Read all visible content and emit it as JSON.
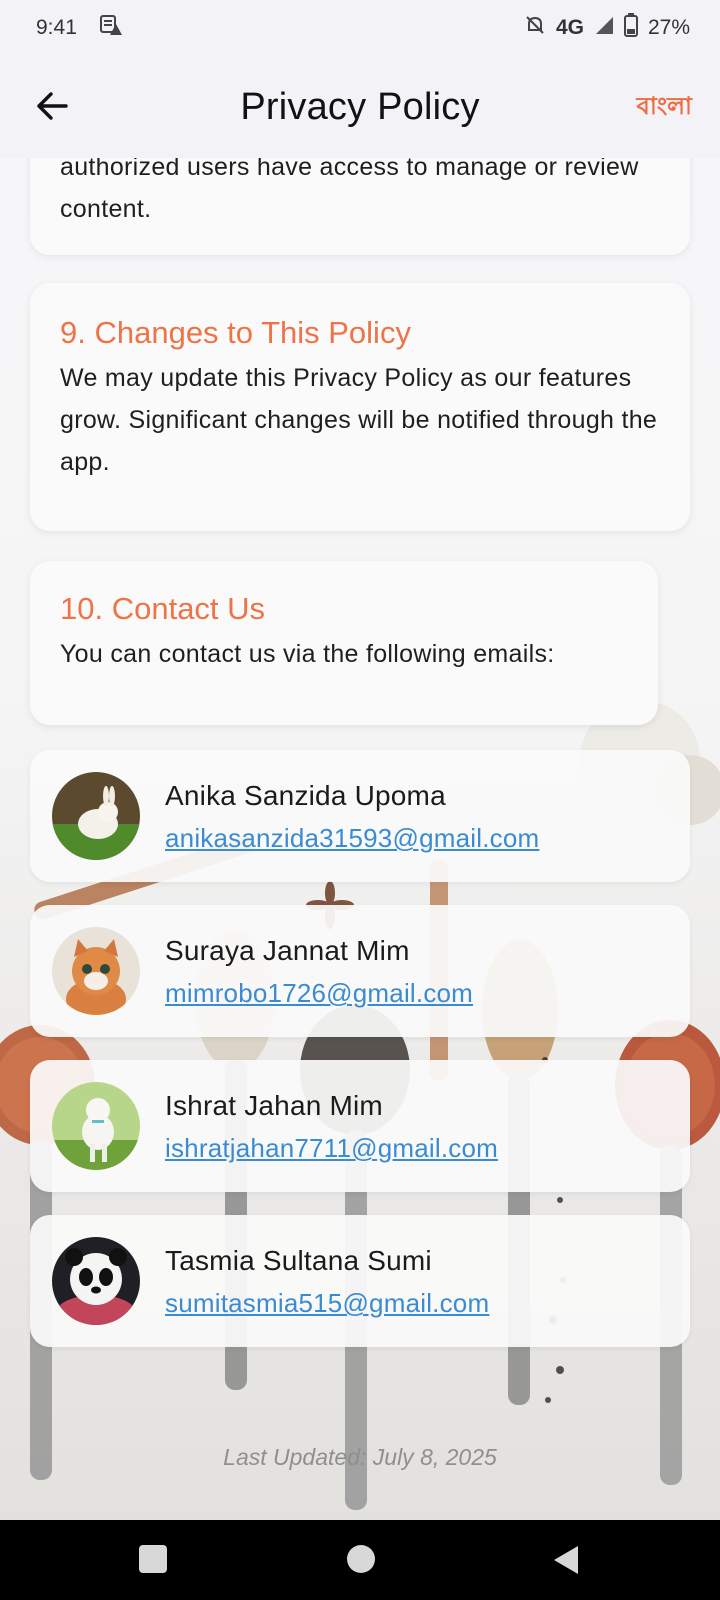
{
  "status_bar": {
    "time": "9:41",
    "network": "4G",
    "battery": "27%"
  },
  "app_bar": {
    "title": "Privacy Policy",
    "language_toggle": "বাংলা"
  },
  "sections": [
    {
      "heading": "",
      "body": "authorized users have access to manage or review content."
    },
    {
      "heading": "9. Changes to This Policy",
      "body": "We may update this Privacy Policy as our features grow. Significant changes will be notified through the app."
    },
    {
      "heading": "10. Contact Us",
      "body": "You can contact us via the following emails:"
    }
  ],
  "contacts": [
    {
      "name": "Anika Sanzida Upoma",
      "email": "anikasanzida31593@gmail.com",
      "avatar": "rabbit-avatar"
    },
    {
      "name": "Suraya Jannat Mim",
      "email": "mimrobo1726@gmail.com",
      "avatar": "kitten-avatar"
    },
    {
      "name": "Ishrat Jahan Mim",
      "email": "ishratjahan7711@gmail.com",
      "avatar": "lamb-avatar"
    },
    {
      "name": "Tasmia Sultana Sumi",
      "email": "sumitasmia515@gmail.com",
      "avatar": "panda-avatar"
    }
  ],
  "footer": {
    "last_updated": "Last Updated: July 8, 2025"
  },
  "colors": {
    "accent": "#ee7448",
    "link": "#3a8bd2"
  }
}
